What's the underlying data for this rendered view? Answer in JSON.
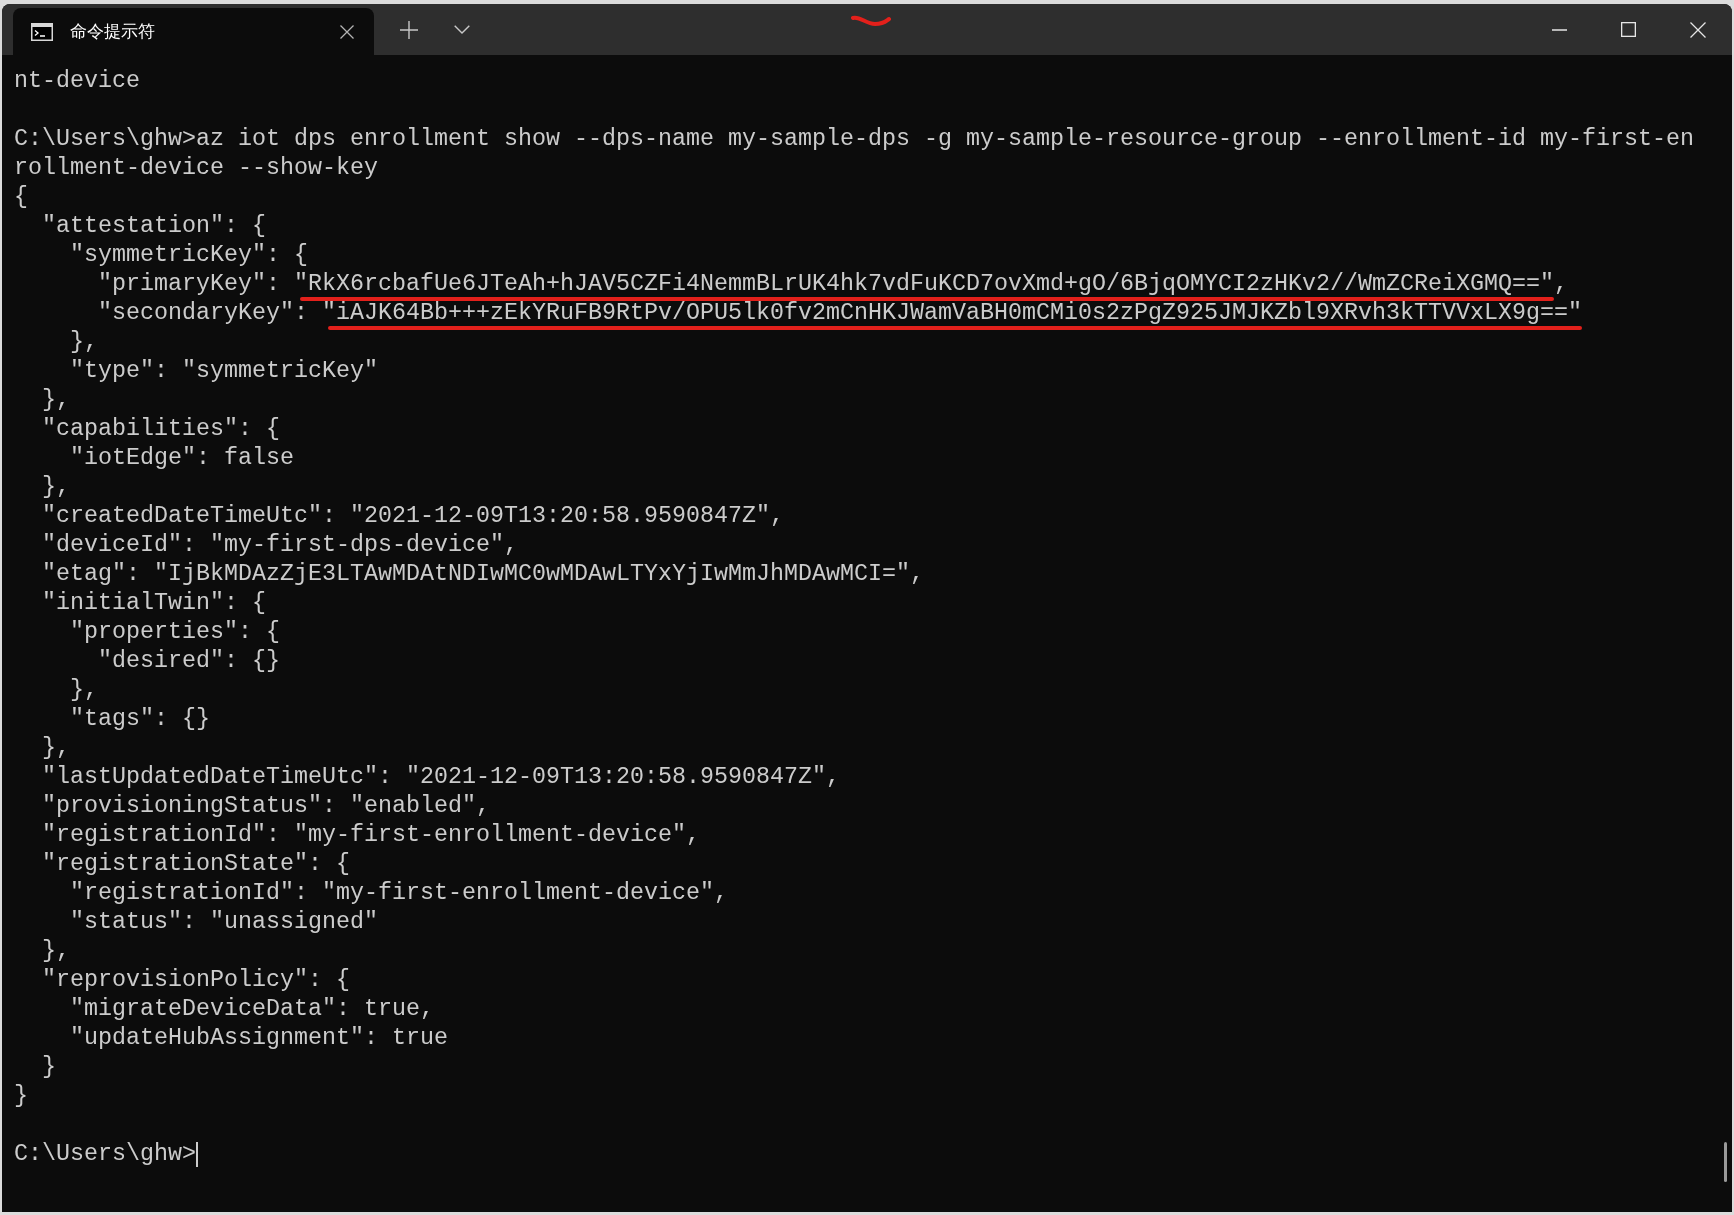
{
  "window": {
    "tabs": [
      {
        "title": "命令提示符",
        "selected": true
      }
    ]
  },
  "terminal": {
    "blocks": [
      {
        "lines": [
          {
            "text": "nt-device",
            "underlined": false
          }
        ]
      },
      {
        "lines": [
          {
            "text": "C:\\Users\\ghw>az iot dps enrollment show --dps-name my-sample-dps -g my-sample-resource-group --enrollment-id my-first-en",
            "underlined": false
          },
          {
            "text": "rollment-device --show-key",
            "underlined": false
          },
          {
            "text": "{",
            "underlined": false
          },
          {
            "text": "  \"attestation\": {",
            "underlined": false
          },
          {
            "text": "    \"symmetricKey\": {",
            "underlined": false
          },
          {
            "text": "      \"primaryKey\": ",
            "value": "\"RkX6rcbafUe6JTeAh+hJAV5CZFi4NemmBLrUK4hk7vdFuKCD7ovXmd+gO/6BjqOMYCI2zHKv2//WmZCReiXGMQ==\"",
            "tail": ",",
            "underlined": true
          },
          {
            "text": "      \"secondaryKey\": ",
            "value": "\"iAJK64Bb+++zEkYRuFB9RtPv/OPU5lk0fv2mCnHKJWamVaBH0mCMi0s2zPgZ925JMJKZbl9XRvh3kTTVVxLX9g==\"",
            "underlined": true
          },
          {
            "text": "    },",
            "underlined": false
          },
          {
            "text": "    \"type\": \"symmetricKey\"",
            "underlined": false
          },
          {
            "text": "  },",
            "underlined": false
          },
          {
            "text": "  \"capabilities\": {",
            "underlined": false
          },
          {
            "text": "    \"iotEdge\": false",
            "underlined": false
          },
          {
            "text": "  },",
            "underlined": false
          },
          {
            "text": "  \"createdDateTimeUtc\": \"2021-12-09T13:20:58.9590847Z\",",
            "underlined": false
          },
          {
            "text": "  \"deviceId\": \"my-first-dps-device\",",
            "underlined": false
          },
          {
            "text": "  \"etag\": \"IjBkMDAzZjE3LTAwMDAtNDIwMC0wMDAwLTYxYjIwMmJhMDAwMCI=\",",
            "underlined": false
          },
          {
            "text": "  \"initialTwin\": {",
            "underlined": false
          },
          {
            "text": "    \"properties\": {",
            "underlined": false
          },
          {
            "text": "      \"desired\": {}",
            "underlined": false
          },
          {
            "text": "    },",
            "underlined": false
          },
          {
            "text": "    \"tags\": {}",
            "underlined": false
          },
          {
            "text": "  },",
            "underlined": false
          },
          {
            "text": "  \"lastUpdatedDateTimeUtc\": \"2021-12-09T13:20:58.9590847Z\",",
            "underlined": false
          },
          {
            "text": "  \"provisioningStatus\": \"enabled\",",
            "underlined": false
          },
          {
            "text": "  \"registrationId\": \"my-first-enrollment-device\",",
            "underlined": false
          },
          {
            "text": "  \"registrationState\": {",
            "underlined": false
          },
          {
            "text": "    \"registrationId\": \"my-first-enrollment-device\",",
            "underlined": false
          },
          {
            "text": "    \"status\": \"unassigned\"",
            "underlined": false
          },
          {
            "text": "  },",
            "underlined": false
          },
          {
            "text": "  \"reprovisionPolicy\": {",
            "underlined": false
          },
          {
            "text": "    \"migrateDeviceData\": true,",
            "underlined": false
          },
          {
            "text": "    \"updateHubAssignment\": true",
            "underlined": false
          },
          {
            "text": "  }",
            "underlined": false
          },
          {
            "text": "}",
            "underlined": false
          }
        ]
      }
    ],
    "prompt": "C:\\Users\\ghw>"
  }
}
